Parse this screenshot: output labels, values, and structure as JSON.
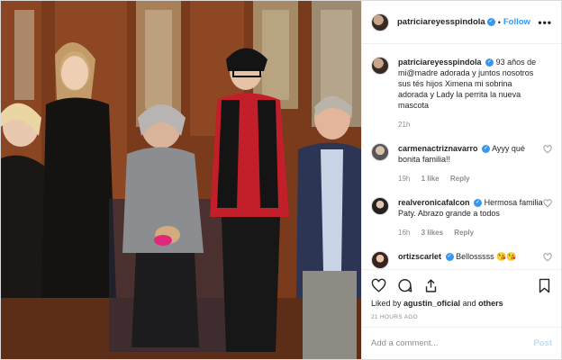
{
  "post": {
    "username": "patriciareyesspindola",
    "follow_label": "Follow",
    "more_label": "•••"
  },
  "caption": {
    "username": "patriciareyesspindola",
    "text": "93 años de mi@madre adorada y juntos nosotros sus tés hijos Ximena mi sobrina adorada y Lady la perrita la nueva mascota",
    "time": "21h"
  },
  "comments": [
    {
      "username": "carmenactriznavarro",
      "text": "Ayyy qué bonita familia!!",
      "time": "19h",
      "likes": "1 like",
      "reply": "Reply"
    },
    {
      "username": "realveronicafalcon",
      "text": "Hermosa familia Paty. Abrazo grande a todos",
      "time": "16h",
      "likes": "3 likes",
      "reply": "Reply"
    },
    {
      "username": "ortizscarlet",
      "text": "Bellosssss 😘😘",
      "time": "",
      "likes": "",
      "reply": ""
    }
  ],
  "liked_by": {
    "prefix": "Liked by",
    "user": "agustin_oficial",
    "middle": "and",
    "others": "others"
  },
  "timestamp": "21 HOURS AGO",
  "add_comment": {
    "placeholder": "Add a comment...",
    "post_label": "Post"
  },
  "colors": {
    "link_blue": "#3897f0",
    "muted": "#8e8e8e",
    "post_disabled": "#b2dffc"
  }
}
